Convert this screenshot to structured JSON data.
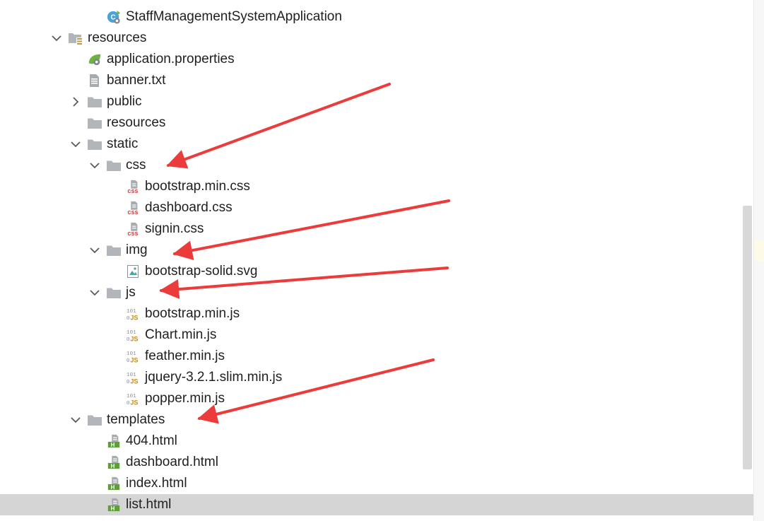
{
  "tree": {
    "items": [
      {
        "label": "StaffManagementSystemApplication",
        "icon": "spring-class-icon",
        "expanded": null
      },
      {
        "label": "resources",
        "icon": "resources-folder-icon",
        "expanded": true
      },
      {
        "label": "application.properties",
        "icon": "spring-properties-icon",
        "expanded": null
      },
      {
        "label": "banner.txt",
        "icon": "text-file-icon",
        "expanded": null
      },
      {
        "label": "public",
        "icon": "folder-icon",
        "expanded": false
      },
      {
        "label": "resources",
        "icon": "folder-icon",
        "expanded": null
      },
      {
        "label": "static",
        "icon": "folder-icon",
        "expanded": true
      },
      {
        "label": "css",
        "icon": "folder-icon",
        "expanded": true
      },
      {
        "label": "bootstrap.min.css",
        "icon": "css-file-icon",
        "expanded": null
      },
      {
        "label": "dashboard.css",
        "icon": "css-file-icon",
        "expanded": null
      },
      {
        "label": "signin.css",
        "icon": "css-file-icon",
        "expanded": null
      },
      {
        "label": "img",
        "icon": "folder-icon",
        "expanded": true
      },
      {
        "label": "bootstrap-solid.svg",
        "icon": "image-file-icon",
        "expanded": null
      },
      {
        "label": "js",
        "icon": "folder-icon",
        "expanded": true
      },
      {
        "label": "bootstrap.min.js",
        "icon": "js-file-icon",
        "expanded": null
      },
      {
        "label": "Chart.min.js",
        "icon": "js-file-icon",
        "expanded": null
      },
      {
        "label": "feather.min.js",
        "icon": "js-file-icon",
        "expanded": null
      },
      {
        "label": "jquery-3.2.1.slim.min.js",
        "icon": "js-file-icon",
        "expanded": null
      },
      {
        "label": "popper.min.js",
        "icon": "js-file-icon",
        "expanded": null
      },
      {
        "label": "templates",
        "icon": "folder-icon",
        "expanded": true
      },
      {
        "label": "404.html",
        "icon": "html-file-icon",
        "expanded": null
      },
      {
        "label": "dashboard.html",
        "icon": "html-file-icon",
        "expanded": null
      },
      {
        "label": "index.html",
        "icon": "html-file-icon",
        "expanded": null
      },
      {
        "label": "list.html",
        "icon": "html-file-icon",
        "expanded": null,
        "selected": true
      }
    ]
  },
  "file_badges": {
    "css": "css",
    "js": "JS",
    "js_bits": "101",
    "js_zero": "0",
    "html": "H"
  },
  "colors": {
    "selection": "#d5d5d5",
    "folder": "#b2b6ba",
    "arrow": "#ec3b3b",
    "css_badge": "#c8454a",
    "js_badge": "#c98a17",
    "html_badge": "#5d9d3a",
    "spring_green": "#6db33f"
  }
}
